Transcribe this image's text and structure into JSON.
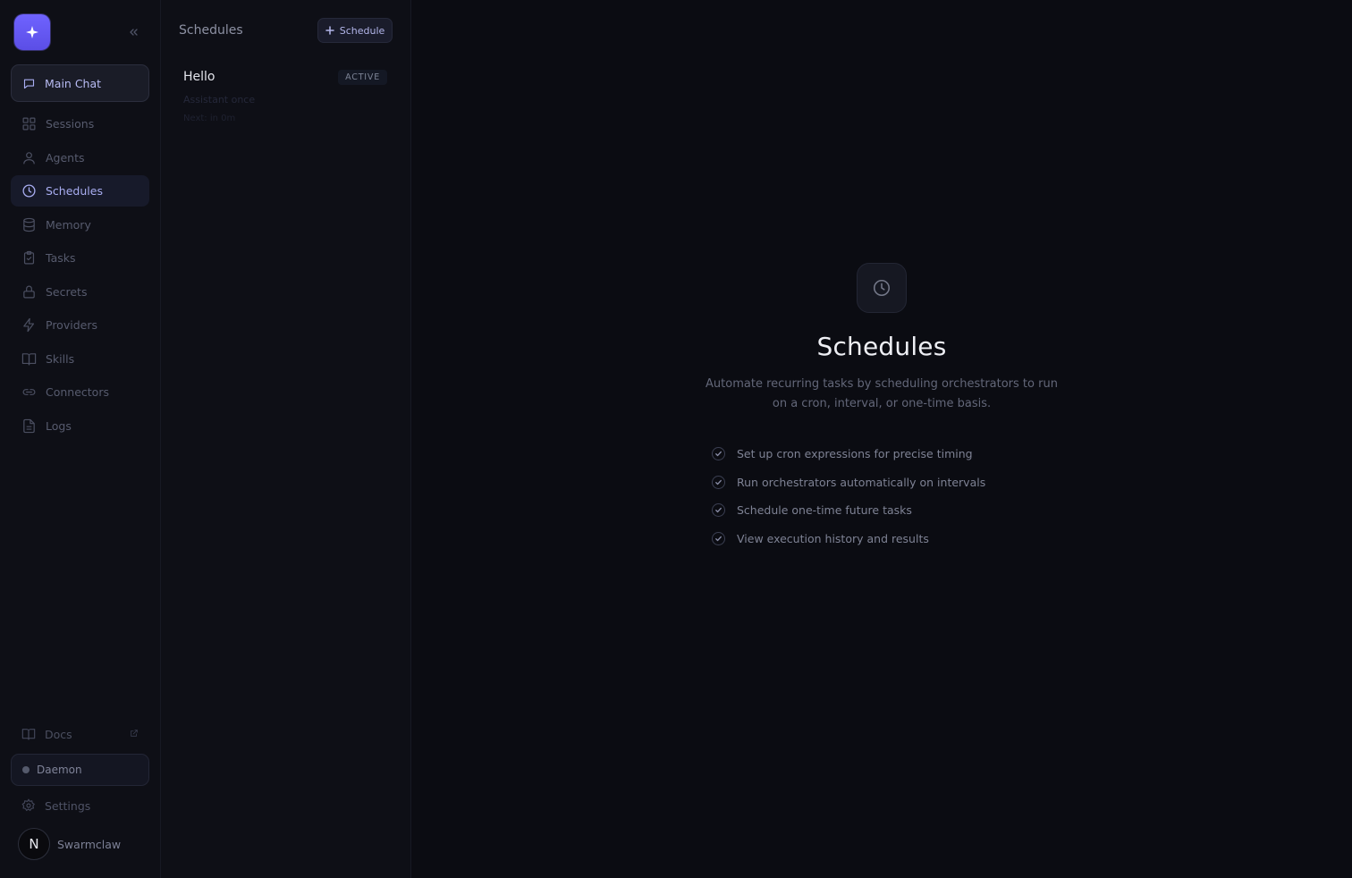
{
  "sidebar": {
    "main_chat": "Main Chat",
    "items": [
      {
        "label": "Sessions",
        "icon": "grid-icon"
      },
      {
        "label": "Agents",
        "icon": "user-icon"
      },
      {
        "label": "Schedules",
        "icon": "clock-icon",
        "active": true
      },
      {
        "label": "Memory",
        "icon": "database-icon"
      },
      {
        "label": "Tasks",
        "icon": "clipboard-icon"
      },
      {
        "label": "Secrets",
        "icon": "lock-icon"
      },
      {
        "label": "Providers",
        "icon": "bolt-icon"
      },
      {
        "label": "Skills",
        "icon": "book-icon"
      },
      {
        "label": "Connectors",
        "icon": "link-icon"
      },
      {
        "label": "Logs",
        "icon": "document-icon"
      }
    ],
    "docs": "Docs",
    "daemon": "Daemon",
    "settings": "Settings",
    "user": {
      "initial": "N",
      "name": "Swarmclaw"
    }
  },
  "list": {
    "title": "Schedules",
    "add_button": "Schedule",
    "schedules": [
      {
        "name": "Hello",
        "status": "ACTIVE",
        "meta": "Assistant  once",
        "next": "Next: in 0m"
      }
    ]
  },
  "main": {
    "title": "Schedules",
    "description": "Automate recurring tasks by scheduling orchestrators to run on a cron, interval, or one-time basis.",
    "features": [
      "Set up cron expressions for precise timing",
      "Run orchestrators automatically on intervals",
      "Schedule one-time future tasks",
      "View execution history and results"
    ]
  },
  "colors": {
    "accent": "#6f63ff",
    "background": "#0b0c12",
    "panel": "#0e0f16",
    "active_text": "#a9aef2"
  }
}
